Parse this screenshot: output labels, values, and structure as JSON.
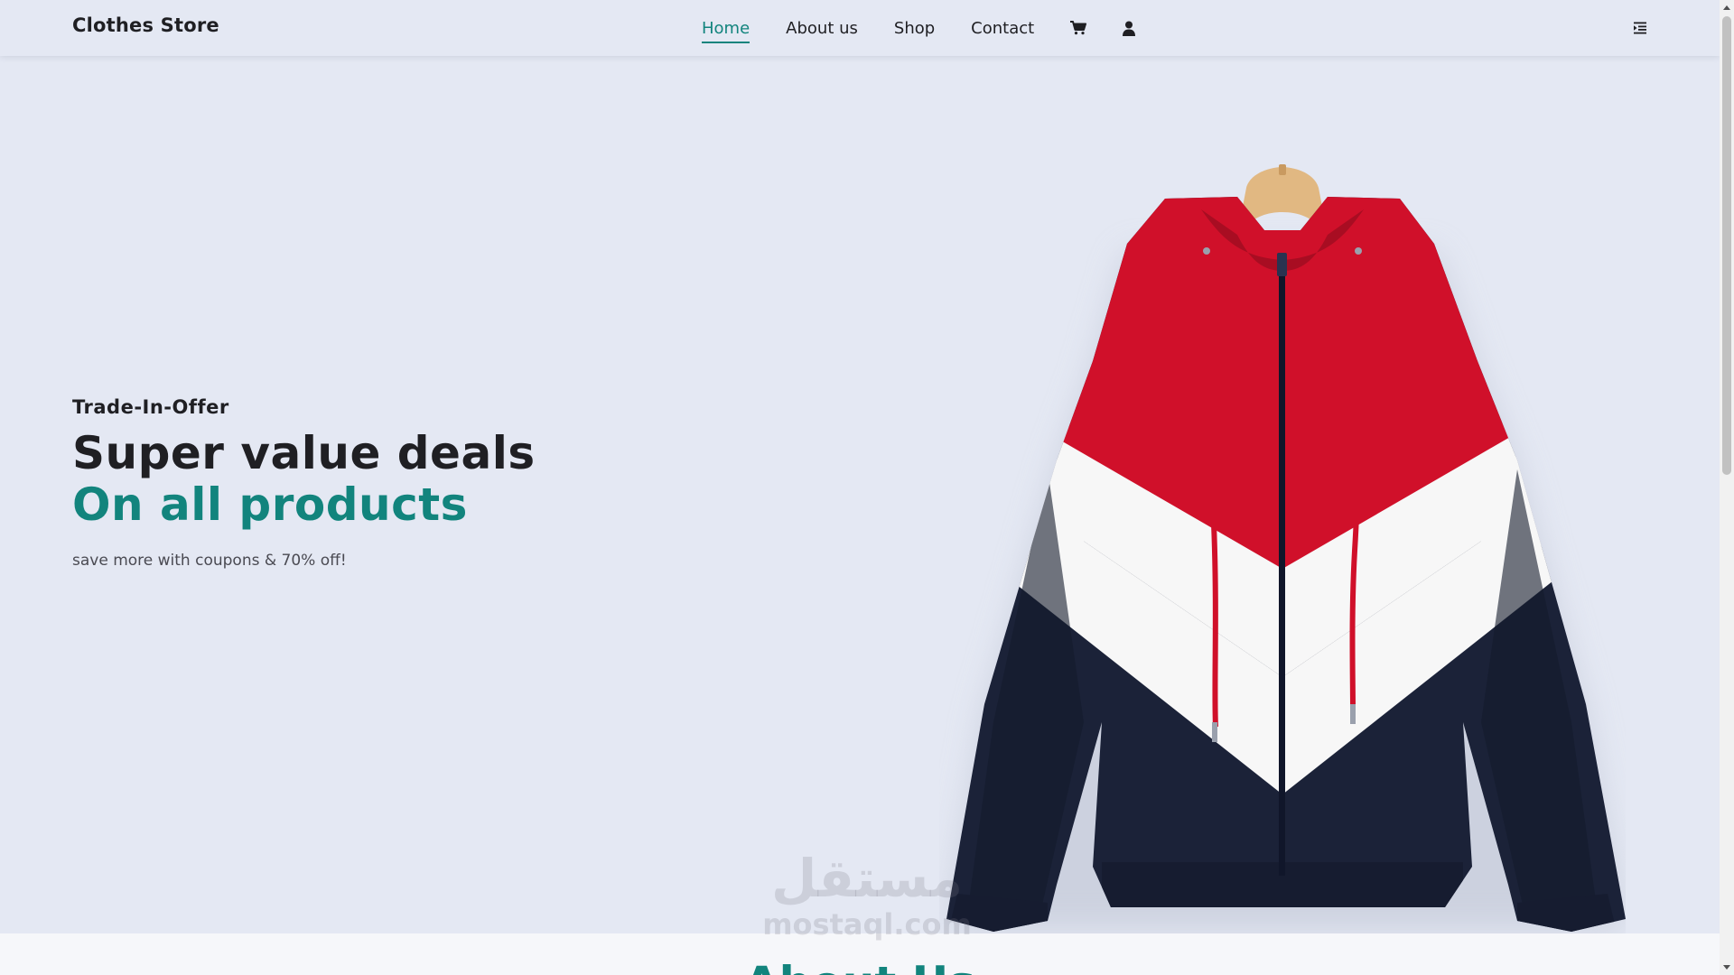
{
  "header": {
    "brand": "Clothes Store",
    "nav": [
      {
        "label": "Home",
        "active": true
      },
      {
        "label": "About us",
        "active": false
      },
      {
        "label": "Shop",
        "active": false
      },
      {
        "label": "Contact",
        "active": false
      }
    ],
    "icons": [
      "cart-icon",
      "user-icon"
    ],
    "menu_icon": "menu-indent-icon"
  },
  "hero": {
    "offer": "Trade-In-Offer",
    "headline": "Super value deals",
    "subheadline": "On all products",
    "tagline": "save more with coupons & 70% off!",
    "image": "hooded-windbreaker-jacket"
  },
  "watermark": {
    "arabic": "مستقل",
    "latin": "mostaql.com"
  },
  "about": {
    "title": "About Us"
  },
  "colors": {
    "accent": "#12847d",
    "background": "#e4e8f3",
    "text": "#1f1f23",
    "jacket_red": "#d0102a",
    "jacket_white": "#f7f7f7",
    "jacket_navy": "#1b2238"
  }
}
